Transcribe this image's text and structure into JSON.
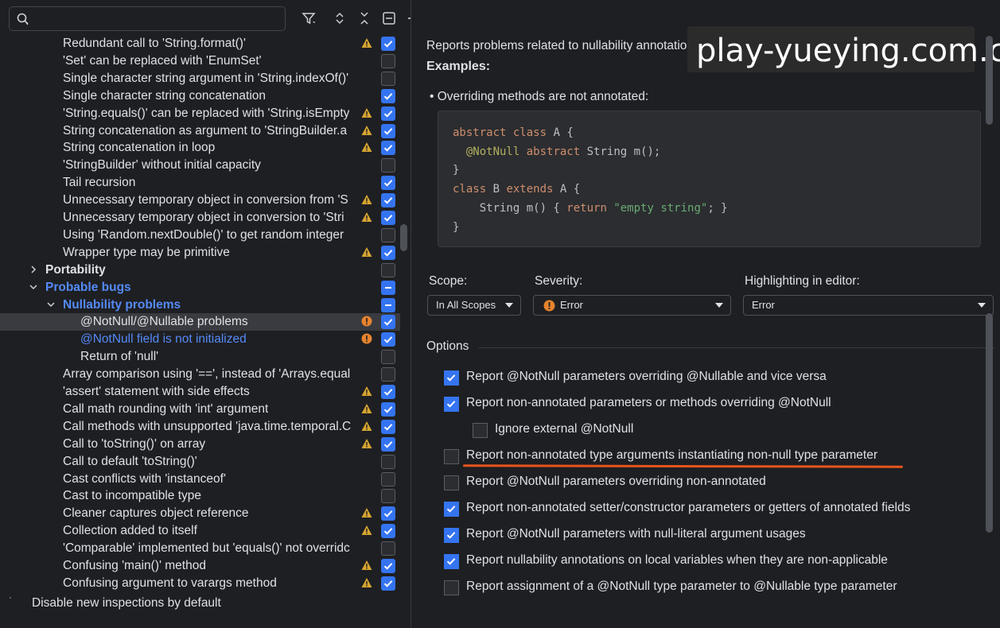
{
  "search": {
    "placeholder": "",
    "value": ""
  },
  "toolbar_icons": [
    "filter-icon",
    "expand-all-icon",
    "collapse-all-icon",
    "collapse-icon",
    "add-icon",
    "remove-icon"
  ],
  "tree": [
    {
      "label": "Redundant call to 'String.format()'",
      "indent": 2,
      "sev": "warning",
      "check": "on"
    },
    {
      "label": "'Set' can be replaced with 'EnumSet'",
      "indent": 2,
      "sev": "",
      "check": "off"
    },
    {
      "label": "Single character string argument in 'String.indexOf()'",
      "indent": 2,
      "sev": "",
      "check": "off"
    },
    {
      "label": "Single character string concatenation",
      "indent": 2,
      "sev": "",
      "check": "on"
    },
    {
      "label": "'String.equals()' can be replaced with 'String.isEmpty",
      "indent": 2,
      "sev": "warning",
      "check": "on"
    },
    {
      "label": "String concatenation as argument to 'StringBuilder.a",
      "indent": 2,
      "sev": "warning",
      "check": "on"
    },
    {
      "label": "String concatenation in loop",
      "indent": 2,
      "sev": "warning",
      "check": "on"
    },
    {
      "label": "'StringBuilder' without initial capacity",
      "indent": 2,
      "sev": "",
      "check": "off"
    },
    {
      "label": "Tail recursion",
      "indent": 2,
      "sev": "",
      "check": "on"
    },
    {
      "label": "Unnecessary temporary object in conversion from 'S",
      "indent": 2,
      "sev": "warning",
      "check": "on"
    },
    {
      "label": "Unnecessary temporary object in conversion to 'Stri",
      "indent": 2,
      "sev": "warning",
      "check": "on"
    },
    {
      "label": "Using 'Random.nextDouble()' to get random integer",
      "indent": 2,
      "sev": "",
      "check": "off"
    },
    {
      "label": "Wrapper type may be primitive",
      "indent": 2,
      "sev": "warning",
      "check": "on"
    },
    {
      "label": "Portability",
      "indent": 1,
      "arrow": "right",
      "style": "bold",
      "sev": "",
      "check": "off"
    },
    {
      "label": "Probable bugs",
      "indent": 1,
      "arrow": "down",
      "style": "bold-blue",
      "sev": "",
      "check": "mixed"
    },
    {
      "label": "Nullability problems",
      "indent": 2,
      "arrow": "down",
      "style": "bold-blue",
      "sev": "",
      "check": "mixed"
    },
    {
      "label": "@NotNull/@Nullable problems",
      "indent": 3,
      "sev": "error",
      "check": "on",
      "selected": true
    },
    {
      "label": "@NotNull field is not initialized",
      "indent": 3,
      "style": "blue",
      "sev": "error",
      "check": "on"
    },
    {
      "label": "Return of 'null'",
      "indent": 3,
      "sev": "",
      "check": "off"
    },
    {
      "label": "Array comparison using '==', instead of 'Arrays.equal",
      "indent": 2,
      "sev": "",
      "check": "off"
    },
    {
      "label": "'assert' statement with side effects",
      "indent": 2,
      "sev": "warning",
      "check": "on"
    },
    {
      "label": "Call math rounding with 'int' argument",
      "indent": 2,
      "sev": "warning",
      "check": "on"
    },
    {
      "label": "Call methods with unsupported 'java.time.temporal.C",
      "indent": 2,
      "sev": "warning",
      "check": "on"
    },
    {
      "label": "Call to 'toString()' on array",
      "indent": 2,
      "sev": "warning",
      "check": "on"
    },
    {
      "label": "Call to default 'toString()'",
      "indent": 2,
      "sev": "",
      "check": "off"
    },
    {
      "label": "Cast conflicts with 'instanceof'",
      "indent": 2,
      "sev": "",
      "check": "off"
    },
    {
      "label": "Cast to incompatible type",
      "indent": 2,
      "sev": "",
      "check": "off"
    },
    {
      "label": "Cleaner captures object reference",
      "indent": 2,
      "sev": "warning",
      "check": "on"
    },
    {
      "label": "Collection added to itself",
      "indent": 2,
      "sev": "warning",
      "check": "on"
    },
    {
      "label": "'Comparable' implemented but 'equals()' not overridc",
      "indent": 2,
      "sev": "",
      "check": "off"
    },
    {
      "label": "Confusing 'main()' method",
      "indent": 2,
      "sev": "warning",
      "check": "on"
    },
    {
      "label": "Confusing argument to varargs method",
      "indent": 2,
      "sev": "warning",
      "check": "on"
    }
  ],
  "bottom_option": {
    "label": "Disable new inspections by default",
    "checked": false
  },
  "details": {
    "description": "Reports problems related to nullability annotations.",
    "examples_label": "Examples:",
    "bullet": "Overriding methods are not annotated:",
    "code": {
      "l1_kw1": "abstract",
      "l1_kw2": "class",
      "l1_rest": " A {",
      "l2_ann": "@NotNull",
      "l2_kw": "abstract",
      "l2_rest": " String m();",
      "l3": "}",
      "l4_kw1": "class",
      "l4_mid": " B ",
      "l4_kw2": "extends",
      "l4_rest": " A {",
      "l5_a": "String m() { ",
      "l5_kw": "return",
      "l5_str": "\"empty string\"",
      "l5_b": "; }",
      "l6": "}"
    }
  },
  "watermark": "play-yueying.com.cn",
  "scope": {
    "label": "Scope:",
    "value": "In All Scopes"
  },
  "severity": {
    "label": "Severity:",
    "value": "Error"
  },
  "highlighting": {
    "label": "Highlighting in editor:",
    "value": "Error"
  },
  "options": {
    "title": "Options",
    "items": [
      {
        "label": "Report @NotNull parameters overriding @Nullable and vice versa",
        "checked": true,
        "indent": 0
      },
      {
        "label": "Report non-annotated parameters or methods overriding @NotNull",
        "checked": true,
        "indent": 0
      },
      {
        "label": "Ignore external @NotNull",
        "checked": false,
        "indent": 1
      },
      {
        "label": "Report non-annotated type arguments instantiating non-null type parameter",
        "checked": false,
        "indent": 0
      },
      {
        "label": "Report @NotNull parameters overriding non-annotated",
        "checked": false,
        "indent": 0
      },
      {
        "label": "Report non-annotated setter/constructor parameters or getters of annotated fields",
        "checked": true,
        "indent": 0
      },
      {
        "label": "Report @NotNull parameters with null-literal argument usages",
        "checked": true,
        "indent": 0
      },
      {
        "label": "Report nullability annotations on local variables when they are non-applicable",
        "checked": true,
        "indent": 0
      },
      {
        "label": "Report assignment of a @NotNull type parameter to @Nullable type parameter",
        "checked": false,
        "indent": 0
      }
    ]
  },
  "colors": {
    "accent": "#3574f0",
    "link": "#548af7",
    "warning": "#d6a531",
    "error": "#e5832d",
    "underline": "#e8541c",
    "background": "#1e1f22"
  }
}
